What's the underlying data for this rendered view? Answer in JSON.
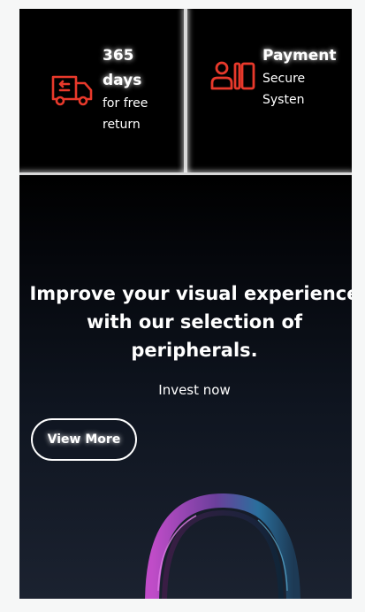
{
  "features": [
    {
      "icon": "delivery-truck-return-icon",
      "title": "365 days",
      "subtitle": "for free return"
    },
    {
      "icon": "secure-payment-icon",
      "title": "Payment",
      "subtitle": "Secure Systen"
    }
  ],
  "hero": {
    "title": "Improve your visual experience with our selection of peripherals.",
    "subtitle": "Invest now",
    "button_label": "View More",
    "image": "headphones-image"
  },
  "colors": {
    "accent_icon": "#e8392b",
    "page_background": "#f6f7f7",
    "panel_background": "#000000",
    "hero_gradient_bottom": "#1b2230"
  }
}
